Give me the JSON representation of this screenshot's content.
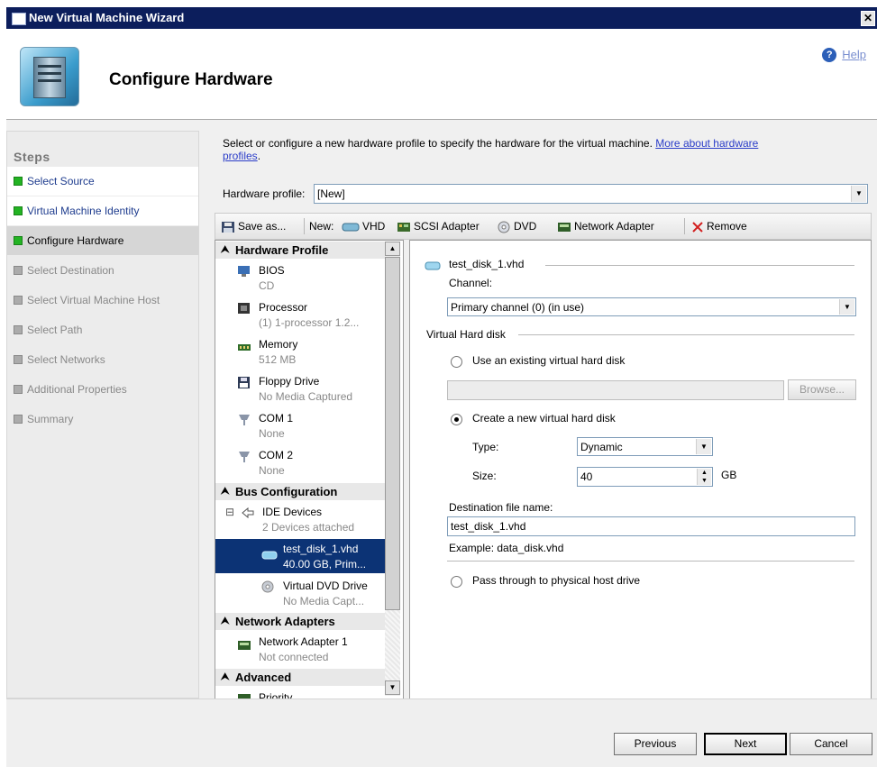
{
  "window": {
    "title": "New Virtual Machine Wizard",
    "close_glyph": "✕"
  },
  "header": {
    "title": "Configure Hardware",
    "help_label": "Help",
    "help_icon": "help-icon"
  },
  "steps": {
    "heading": "Steps",
    "items": [
      {
        "label": "Select Source",
        "state": "done"
      },
      {
        "label": "Virtual Machine Identity",
        "state": "done"
      },
      {
        "label": "Configure Hardware",
        "state": "current"
      },
      {
        "label": "Select Destination",
        "state": "pending"
      },
      {
        "label": "Select Virtual Machine Host",
        "state": "pending"
      },
      {
        "label": "Select Path",
        "state": "pending"
      },
      {
        "label": "Select Networks",
        "state": "pending"
      },
      {
        "label": "Additional Properties",
        "state": "pending"
      },
      {
        "label": "Summary",
        "state": "pending"
      }
    ]
  },
  "main": {
    "description": "Select or configure a new hardware profile to specify the hardware for the virtual machine.",
    "more_link_1": "More about hardware",
    "more_link_2": "profiles",
    "more_link_suffix": ".",
    "hw_profile_label": "Hardware profile:",
    "hw_profile_value": "[New]"
  },
  "toolbar": {
    "save_as": "Save as...",
    "new_label": "New:",
    "vhd": "VHD",
    "scsi": "SCSI Adapter",
    "dvd": "DVD",
    "network": "Network Adapter",
    "remove": "Remove"
  },
  "tree": {
    "hardware_profile": "Hardware Profile",
    "bios": {
      "name": "BIOS",
      "sub": "CD"
    },
    "processor": {
      "name": "Processor",
      "sub": "(1) 1-processor 1.2..."
    },
    "memory": {
      "name": "Memory",
      "sub": "512 MB"
    },
    "floppy": {
      "name": "Floppy Drive",
      "sub": "No Media Captured"
    },
    "com1": {
      "name": "COM 1",
      "sub": "None"
    },
    "com2": {
      "name": "COM 2",
      "sub": "None"
    },
    "bus_configuration": "Bus Configuration",
    "ide": {
      "name": "IDE Devices",
      "sub": "2 Devices attached",
      "expander": "⊟"
    },
    "disk": {
      "name": "test_disk_1.vhd",
      "sub": "40.00 GB, Prim..."
    },
    "dvd": {
      "name": "Virtual DVD Drive",
      "sub": "No Media Capt..."
    },
    "network_adapters": "Network Adapters",
    "netadapter": {
      "name": "Network Adapter 1",
      "sub": "Not connected"
    },
    "advanced": "Advanced",
    "priority": {
      "name": "Priority"
    }
  },
  "panel": {
    "disk_title": "test_disk_1.vhd",
    "channel_label": "Channel:",
    "channel_value": "Primary channel (0) (in use)",
    "vhd_group": "Virtual Hard disk",
    "use_existing": "Use an existing virtual hard disk",
    "existing_path": "",
    "browse": "Browse...",
    "create_new": "Create a new virtual hard disk",
    "type_label": "Type:",
    "type_value": "Dynamic",
    "size_label": "Size:",
    "size_value": "40",
    "size_unit": "GB",
    "dest_label": "Destination file name:",
    "dest_value": "test_disk_1.vhd",
    "example": "Example: data_disk.vhd",
    "pass_through": "Pass through to physical host drive",
    "selected_option": "create_new"
  },
  "footer": {
    "previous": "Previous",
    "next": "Next",
    "cancel": "Cancel"
  }
}
